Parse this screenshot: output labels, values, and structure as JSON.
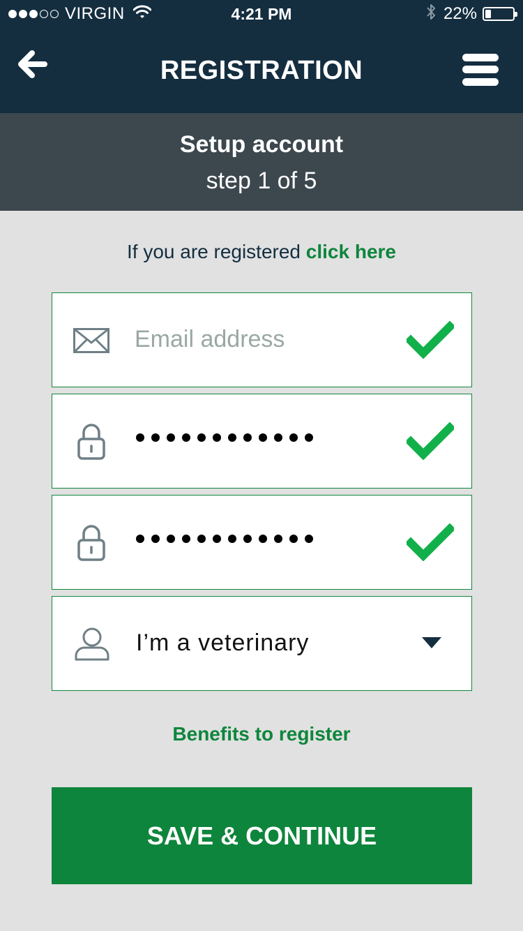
{
  "status_bar": {
    "carrier": "VIRGIN",
    "signal_full": 3,
    "signal_total": 5,
    "time": "4:21 PM",
    "battery_text": "22%",
    "battery_level": 0.22
  },
  "nav": {
    "title": "REGISTRATION",
    "back_icon": "back-arrow-icon",
    "menu_icon": "hamburger-menu-icon"
  },
  "step": {
    "title": "Setup account",
    "subtitle": "step 1 of 5"
  },
  "registered": {
    "prefix": "If you are registered",
    "link": "click here"
  },
  "fields": {
    "email": {
      "placeholder": "Email address",
      "valid": true
    },
    "password": {
      "masked_length": 12,
      "valid": true
    },
    "confirm_password": {
      "masked_length": 12,
      "valid": true
    },
    "role": {
      "selected": "I’m a veterinary"
    }
  },
  "benefits_link": "Benefits to register",
  "save_button": "SAVE & CONTINUE",
  "colors": {
    "header_bg": "#142e40",
    "step_bg": "#3c474e",
    "accent_green": "#0e853c",
    "check_green": "#12b04a",
    "page_bg": "#e1e1e1"
  }
}
